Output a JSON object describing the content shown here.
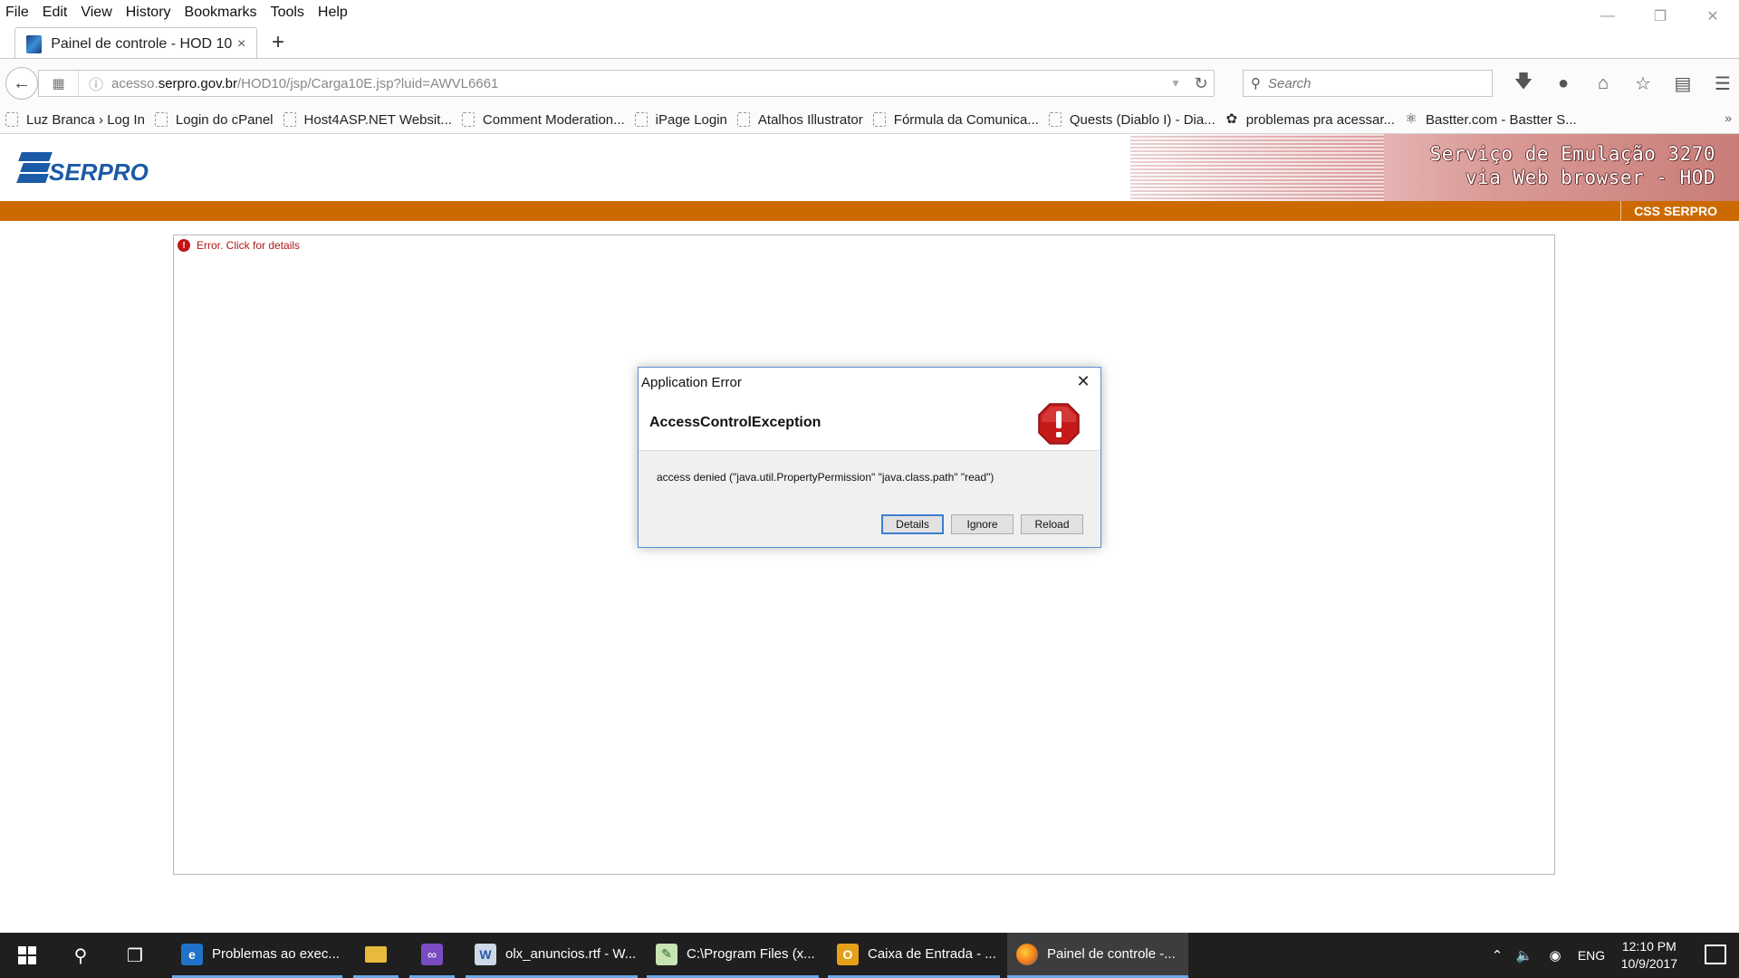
{
  "browser": {
    "menu": [
      "File",
      "Edit",
      "View",
      "History",
      "Bookmarks",
      "Tools",
      "Help"
    ],
    "tab_title": "Painel de controle - HOD 10",
    "tab_close": "×",
    "new_tab": "+",
    "url_host": "acesso.serpro.gov.br",
    "url_prefix": "acesso.",
    "url_domain": "serpro.gov.br",
    "url_path": "/HOD10/jsp/Carga10E.jsp?luid=AWVL6661",
    "search_placeholder": "Search",
    "bookmarks": [
      "Luz Branca › Log In",
      "Login do cPanel",
      "Host4ASP.NET Websit...",
      "Comment Moderation...",
      "iPage Login",
      "Atalhos Illustrator",
      "Fórmula da Comunica...",
      "Quests (Diablo I) - Dia...",
      "problemas pra acessar...",
      "Bastter.com - Bastter S..."
    ]
  },
  "page": {
    "logo_text": "SERPRO",
    "banner_line1": "Serviço de Emulação 3270",
    "banner_line2": "via Web browser - HOD",
    "orange_label": "CSS SERPRO",
    "applet_error": "Error. Click for details"
  },
  "dialog": {
    "title": "Application Error",
    "heading": "AccessControlException",
    "message": "access denied (\"java.util.PropertyPermission\" \"java.class.path\" \"read\")",
    "buttons": {
      "details": "Details",
      "ignore": "Ignore",
      "reload": "Reload"
    }
  },
  "taskbar": {
    "apps": [
      {
        "label": "Problemas ao exec...",
        "icon": "edge-icon"
      },
      {
        "label": "olx_anuncios.rtf - W...",
        "icon": "wordpad-icon"
      },
      {
        "label": "C:\\Program Files (x...",
        "icon": "notepad-icon"
      },
      {
        "label": "Caixa de Entrada - ...",
        "icon": "outlook-icon"
      },
      {
        "label": "Painel de controle -...",
        "icon": "firefox-icon"
      }
    ],
    "language": "ENG",
    "time": "12:10 PM",
    "date": "10/9/2017"
  },
  "colors": {
    "orange_bar": "#cc6a00",
    "serpro_blue": "#1b5aa6",
    "error_red": "#c31515",
    "taskbar": "#1f1f1f"
  }
}
